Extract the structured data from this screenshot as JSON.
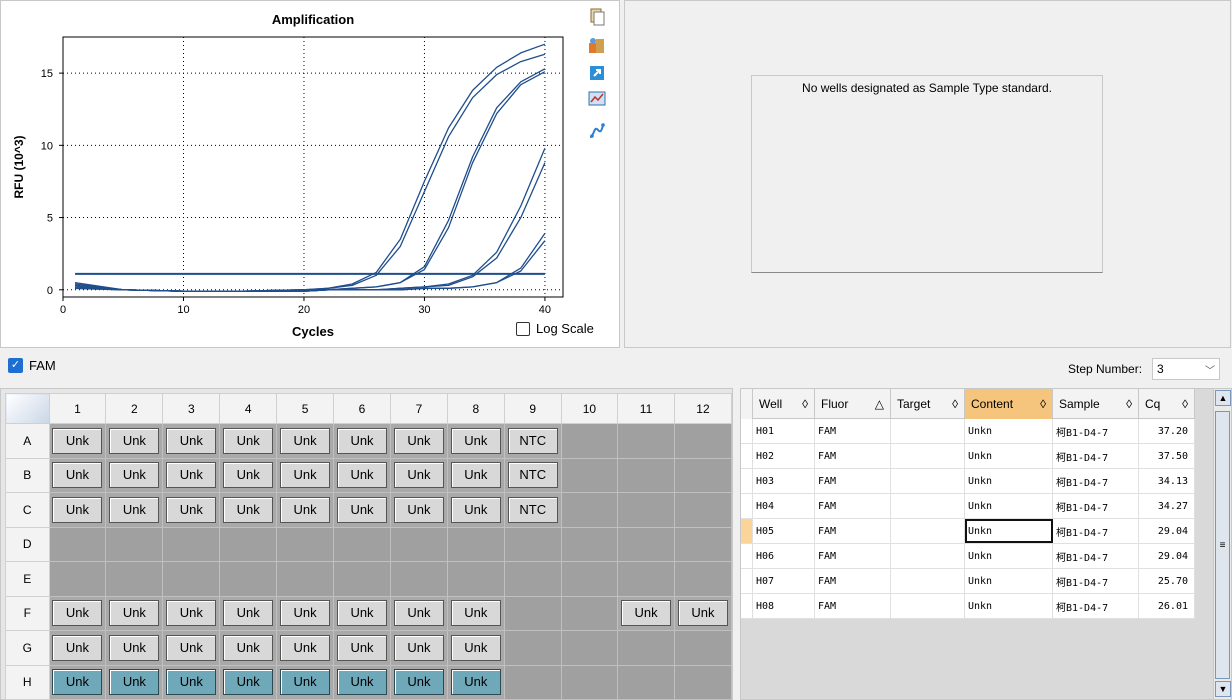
{
  "chart": {
    "title": "Amplification",
    "xlabel": "Cycles",
    "ylabel": "RFU (10^3)",
    "x_ticks": [
      "0",
      "10",
      "20",
      "30",
      "40"
    ],
    "y_ticks": [
      "0",
      "5",
      "10",
      "15"
    ],
    "log_scale_label": "Log Scale",
    "toolbar_icons": [
      "copy-icon",
      "palette-icon",
      "export-icon",
      "chart-settings-icon",
      "curve-fit-icon"
    ]
  },
  "chart_data": {
    "type": "line",
    "title": "Amplification",
    "xlabel": "Cycles",
    "ylabel": "RFU (10^3)",
    "xlim": [
      0,
      41.5
    ],
    "ylim": [
      -0.5,
      17.5
    ],
    "grid": true,
    "series_color": "#1f4e8c",
    "threshold": 1.1,
    "x": [
      1,
      5,
      10,
      15,
      20,
      22,
      24,
      26,
      28,
      30,
      32,
      34,
      36,
      38,
      40
    ],
    "series": [
      {
        "values": [
          0.4,
          0.0,
          -0.1,
          -0.1,
          0.0,
          0.1,
          0.4,
          1.2,
          3.5,
          7.5,
          11.2,
          13.8,
          15.4,
          16.4,
          17.0
        ]
      },
      {
        "values": [
          0.5,
          0.0,
          -0.1,
          -0.1,
          0.0,
          0.1,
          0.3,
          1.0,
          3.0,
          6.8,
          10.6,
          13.3,
          14.9,
          15.8,
          16.3
        ]
      },
      {
        "values": [
          0.3,
          0.0,
          -0.1,
          -0.1,
          0.0,
          0.0,
          0.1,
          0.2,
          0.5,
          1.6,
          4.8,
          9.2,
          12.6,
          14.4,
          15.3
        ]
      },
      {
        "values": [
          0.3,
          0.0,
          -0.1,
          -0.1,
          0.0,
          0.0,
          0.1,
          0.2,
          0.5,
          1.4,
          4.3,
          8.8,
          12.2,
          14.2,
          15.1
        ]
      },
      {
        "values": [
          0.2,
          0.0,
          -0.1,
          -0.1,
          -0.1,
          0.0,
          0.0,
          0.0,
          0.1,
          0.2,
          0.4,
          1.0,
          2.6,
          5.8,
          9.8
        ]
      },
      {
        "values": [
          0.2,
          0.0,
          -0.1,
          -0.1,
          -0.1,
          0.0,
          0.0,
          0.0,
          0.1,
          0.2,
          0.3,
          0.9,
          2.2,
          5.0,
          8.8
        ]
      },
      {
        "values": [
          0.1,
          0.0,
          -0.1,
          -0.1,
          -0.1,
          0.0,
          0.0,
          0.0,
          0.0,
          0.1,
          0.1,
          0.2,
          0.5,
          1.5,
          3.9
        ]
      },
      {
        "values": [
          0.1,
          0.0,
          -0.1,
          -0.1,
          -0.1,
          0.0,
          0.0,
          0.0,
          0.0,
          0.1,
          0.1,
          0.2,
          0.5,
          1.3,
          3.4
        ]
      }
    ]
  },
  "std_curve": {
    "message": "No wells designated as Sample Type standard."
  },
  "fluor": {
    "label": "FAM",
    "checked": true
  },
  "step": {
    "label": "Step Number:",
    "value": "3"
  },
  "plate": {
    "columns": [
      "1",
      "2",
      "3",
      "4",
      "5",
      "6",
      "7",
      "8",
      "9",
      "10",
      "11",
      "12"
    ],
    "rows": [
      {
        "label": "A",
        "cells": [
          "Unk",
          "Unk",
          "Unk",
          "Unk",
          "Unk",
          "Unk",
          "Unk",
          "Unk",
          "NTC",
          "",
          "",
          ""
        ]
      },
      {
        "label": "B",
        "cells": [
          "Unk",
          "Unk",
          "Unk",
          "Unk",
          "Unk",
          "Unk",
          "Unk",
          "Unk",
          "NTC",
          "",
          "",
          ""
        ]
      },
      {
        "label": "C",
        "cells": [
          "Unk",
          "Unk",
          "Unk",
          "Unk",
          "Unk",
          "Unk",
          "Unk",
          "Unk",
          "NTC",
          "",
          "",
          ""
        ]
      },
      {
        "label": "D",
        "cells": [
          "",
          "",
          "",
          "",
          "",
          "",
          "",
          "",
          "",
          "",
          "",
          ""
        ]
      },
      {
        "label": "E",
        "cells": [
          "",
          "",
          "",
          "",
          "",
          "",
          "",
          "",
          "",
          "",
          "",
          ""
        ]
      },
      {
        "label": "F",
        "cells": [
          "Unk",
          "Unk",
          "Unk",
          "Unk",
          "Unk",
          "Unk",
          "Unk",
          "Unk",
          "",
          "",
          "Unk",
          "Unk"
        ]
      },
      {
        "label": "G",
        "cells": [
          "Unk",
          "Unk",
          "Unk",
          "Unk",
          "Unk",
          "Unk",
          "Unk",
          "Unk",
          "",
          "",
          "",
          ""
        ]
      },
      {
        "label": "H",
        "cells": [
          "Unk",
          "Unk",
          "Unk",
          "Unk",
          "Unk",
          "Unk",
          "Unk",
          "Unk",
          "",
          "",
          "",
          ""
        ],
        "selected": true
      }
    ]
  },
  "well_table": {
    "headers": [
      {
        "label": "Well",
        "sort": "◊"
      },
      {
        "label": "Fluor",
        "sort": "△"
      },
      {
        "label": "Target",
        "sort": "◊"
      },
      {
        "label": "Content",
        "sort": "◊"
      },
      {
        "label": "Sample",
        "sort": "◊"
      },
      {
        "label": "Cq",
        "sort": "◊"
      }
    ],
    "rows": [
      [
        "H01",
        "FAM",
        "",
        "Unkn",
        "柯B1-D4-7",
        "37.20"
      ],
      [
        "H02",
        "FAM",
        "",
        "Unkn",
        "柯B1-D4-7",
        "37.50"
      ],
      [
        "H03",
        "FAM",
        "",
        "Unkn",
        "柯B1-D4-7",
        "34.13"
      ],
      [
        "H04",
        "FAM",
        "",
        "Unkn",
        "柯B1-D4-7",
        "34.27"
      ],
      [
        "H05",
        "FAM",
        "",
        "Unkn",
        "柯B1-D4-7",
        "29.04"
      ],
      [
        "H06",
        "FAM",
        "",
        "Unkn",
        "柯B1-D4-7",
        "29.04"
      ],
      [
        "H07",
        "FAM",
        "",
        "Unkn",
        "柯B1-D4-7",
        "25.70"
      ],
      [
        "H08",
        "FAM",
        "",
        "Unkn",
        "柯B1-D4-7",
        "26.01"
      ]
    ],
    "selected_row": 4
  }
}
